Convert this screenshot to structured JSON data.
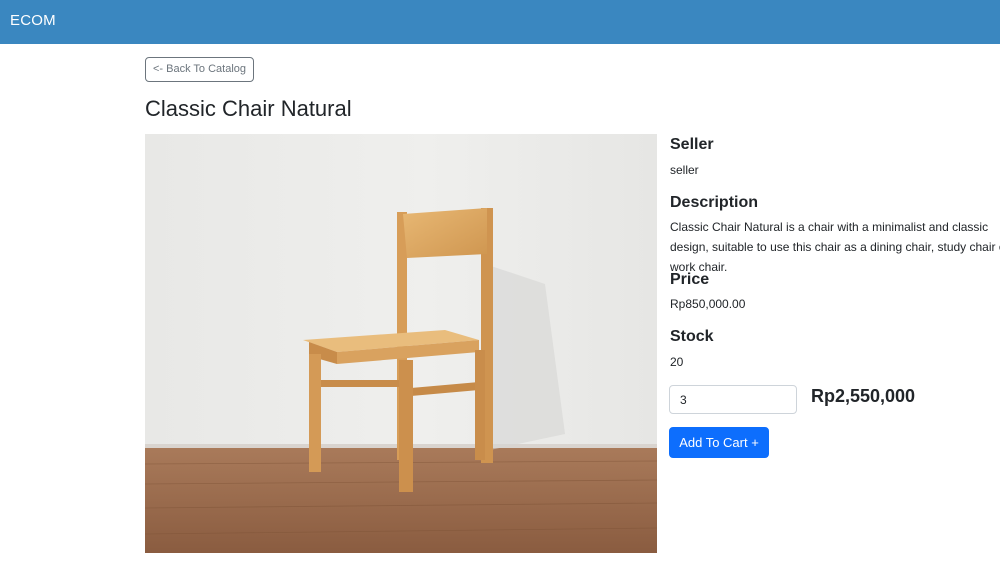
{
  "navbar": {
    "brand": "ECOM",
    "color": "#3a87c0"
  },
  "back_button": {
    "label": "<- Back To Catalog"
  },
  "product": {
    "title": "Classic Chair Natural",
    "image_alt": "Classic Chair Natural",
    "seller_heading": "Seller",
    "seller": "seller",
    "description_heading": "Description",
    "description": "Classic Chair Natural is a chair with a minimalist and classic design, suitable to use this chair as a dining chair, study chair or work chair.",
    "price_heading": "Price",
    "price": "Rp850,000.00",
    "stock_heading": "Stock",
    "stock": "20"
  },
  "cart": {
    "quantity": "3",
    "total": "Rp2,550,000",
    "add_button_label": "Add To Cart +",
    "button_color": "#0d6efd"
  }
}
